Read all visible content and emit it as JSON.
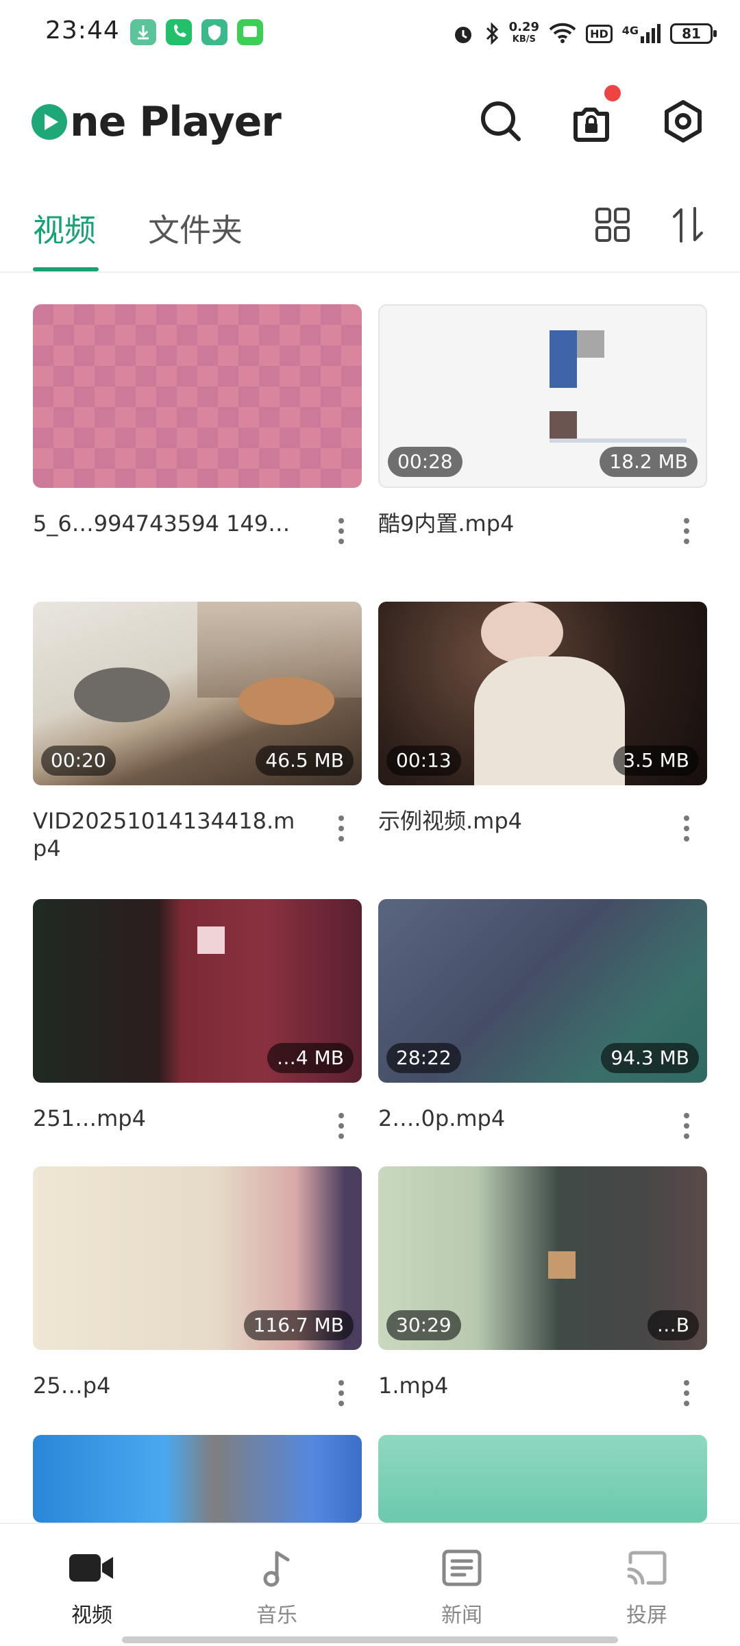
{
  "status_bar": {
    "time": "23:44",
    "net_speed": "0.29",
    "net_speed_unit": "KB/S",
    "hd": "HD",
    "signal": "4G",
    "battery": "81"
  },
  "header": {
    "logo_text": "ne Player"
  },
  "tabs": [
    {
      "label": "视频",
      "active": true
    },
    {
      "label": "文件夹",
      "active": false
    }
  ],
  "videos": [
    {
      "name": "5_6…994743594 149…",
      "duration": "",
      "size": ""
    },
    {
      "name": "酷9内置.mp4",
      "duration": "00:28",
      "size": "18.2 MB"
    },
    {
      "name": "VID20251014134418.mp4",
      "duration": "00:20",
      "size": "46.5 MB"
    },
    {
      "name": "示例视频.mp4",
      "duration": "00:13",
      "size": "3.5 MB"
    },
    {
      "name": "251…mp4",
      "duration": "",
      "size": "…4 MB"
    },
    {
      "name": "2….0p.mp4",
      "duration": "28:22",
      "size": "94.3 MB"
    },
    {
      "name": "25…p4",
      "duration": "",
      "size": "116.7 MB"
    },
    {
      "name": "1.mp4",
      "duration": "30:29",
      "size": "…B"
    }
  ],
  "bottom_nav": [
    {
      "label": "视频",
      "icon": "video-camera-icon",
      "active": true
    },
    {
      "label": "音乐",
      "icon": "music-note-icon",
      "active": false
    },
    {
      "label": "新闻",
      "icon": "news-icon",
      "active": false
    },
    {
      "label": "投屏",
      "icon": "cast-icon",
      "active": false
    }
  ],
  "colors": {
    "accent": "#16a371",
    "notification": "#ee4444"
  }
}
